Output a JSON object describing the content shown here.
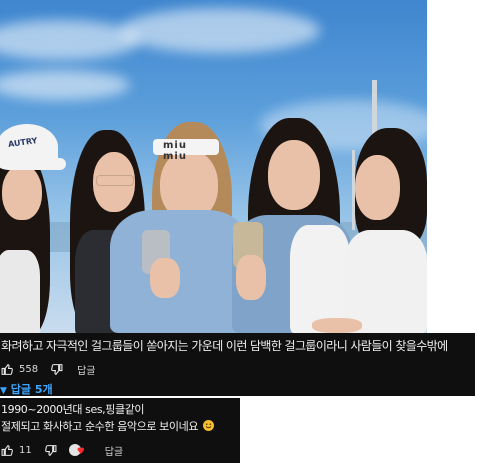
{
  "video": {
    "cap_text": "AUTRY",
    "headband_text": "miu miu"
  },
  "comment": {
    "text": "화려하고 자극적인 걸그룹들이 쏟아지는 가운데 이런 담백한 걸그룹이라니 사람들이 찾을수밖에",
    "like_count": "558",
    "reply_label": "답글",
    "replies_toggle": "답글 5개"
  },
  "reply": {
    "line1": "1990~2000년대 ses,핑클같이",
    "line2": "절제되고 화사하고 순수한 음악으로 보이네요",
    "like_count": "11",
    "reply_label": "답글"
  },
  "colors": {
    "panel_bg": "#0f0f0f",
    "text": "#f1f1f1",
    "link_blue": "#3ea6ff",
    "heart_red": "#ff2b2b"
  },
  "icons": {
    "like": "thumb-up-icon",
    "dislike": "thumb-down-icon",
    "toggle": "caret-down-icon",
    "creator_heart": "heart-icon"
  }
}
